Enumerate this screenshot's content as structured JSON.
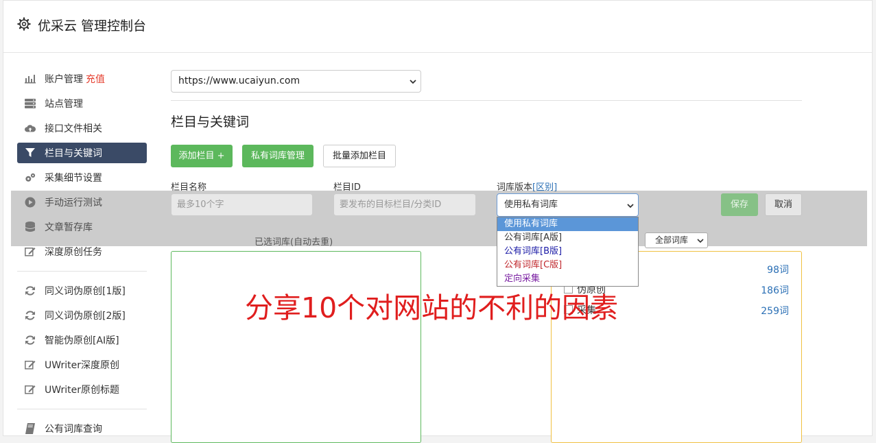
{
  "header": {
    "title": "优采云 管理控制台"
  },
  "sidebar": {
    "items": [
      {
        "label": "账户管理",
        "badge": "充值",
        "icon": "bar-chart-icon"
      },
      {
        "label": "站点管理",
        "icon": "server-icon"
      },
      {
        "label": "接口文件相关",
        "icon": "cloud-upload-icon"
      },
      {
        "label": "栏目与关键词",
        "icon": "filter-icon",
        "active": true
      },
      {
        "label": "采集细节设置",
        "icon": "cogs-icon"
      },
      {
        "label": "手动运行测试",
        "icon": "play-circle-icon"
      },
      {
        "label": "文章暂存库",
        "icon": "database-icon"
      },
      {
        "label": "深度原创任务",
        "icon": "edit-icon"
      },
      {
        "label": "同义词伪原创[1版]",
        "icon": "refresh-icon"
      },
      {
        "label": "同义词伪原创[2版]",
        "icon": "refresh-icon"
      },
      {
        "label": "智能伪原创[AI版]",
        "icon": "refresh-icon"
      },
      {
        "label": "UWriter深度原创",
        "icon": "edit-icon"
      },
      {
        "label": "UWriter原创标题",
        "icon": "edit-icon"
      },
      {
        "label": "公有词库查询",
        "icon": "book-icon"
      }
    ]
  },
  "site_select": {
    "value": "https://www.ucaiyun.com"
  },
  "section": {
    "title": "栏目与关键词"
  },
  "buttons": {
    "add_column": "添加栏目 +",
    "private_lib": "私有词库管理",
    "batch_add": "批量添加栏目",
    "save": "保存",
    "cancel": "取消"
  },
  "form": {
    "name_label": "栏目名称",
    "name_placeholder": "最多10个字",
    "id_label": "栏目ID",
    "id_placeholder": "要发布的目标栏目/分类ID",
    "version_label": "词库版本",
    "version_link": "[区别]",
    "version_value": "使用私有词库"
  },
  "dropdown": {
    "options": [
      {
        "label": "使用私有词库",
        "color": "#ffffff"
      },
      {
        "label": "公有词库[A版]",
        "color": "#333333"
      },
      {
        "label": "公有词库[B版]",
        "color": "#1a1aa6"
      },
      {
        "label": "公有词库[C版]",
        "color": "#c0282d"
      },
      {
        "label": "定向采集",
        "color": "#7a1fa2"
      }
    ]
  },
  "panels": {
    "selected_title": "已选词库(自动去重)",
    "filter_value": "全部词库",
    "rows": [
      {
        "label": "",
        "count": "98词"
      },
      {
        "label": "伪原创",
        "count": "186词"
      },
      {
        "label": "采集",
        "count": "259词"
      }
    ]
  },
  "banner": {
    "text": "分享10个对网站的不利的因素"
  },
  "colors": {
    "accent": "#5cb85c",
    "active_nav": "#3a4a66",
    "banner": "#e01e1e"
  }
}
